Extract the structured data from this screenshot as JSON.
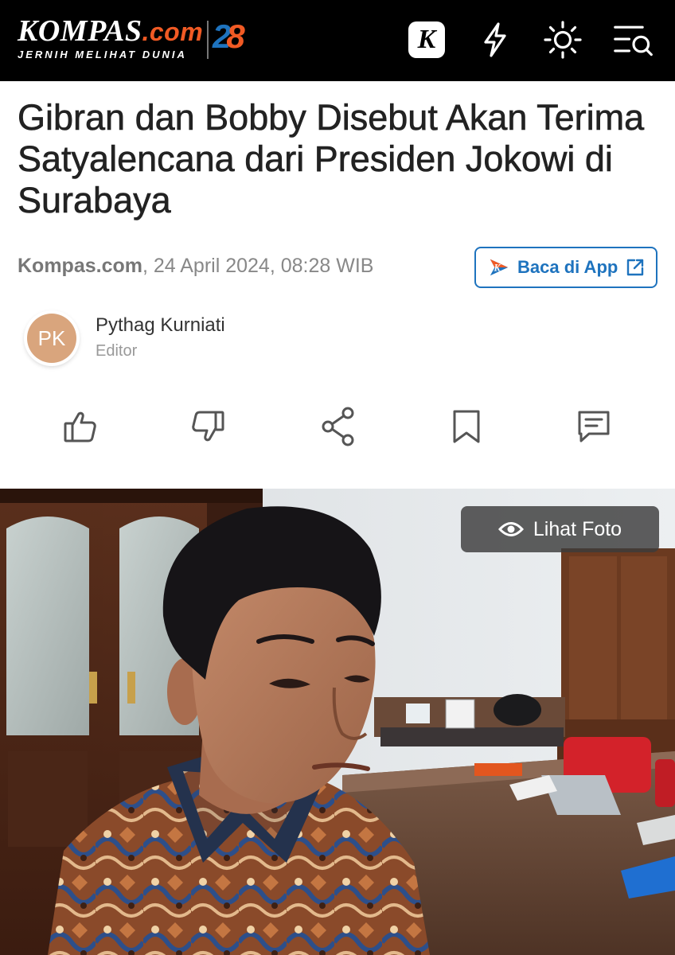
{
  "header": {
    "logo_name": "KOMPAS",
    "logo_dotcom": ".com",
    "logo_tagline": "JERNIH MELIHAT DUNIA",
    "logo_anniv_a": "2",
    "logo_anniv_b": "8",
    "k_badge": "K",
    "icons": [
      "k-badge-icon",
      "lightning-icon",
      "sun-icon",
      "menu-search-icon"
    ]
  },
  "article": {
    "title": "Gibran dan Bobby Disebut Akan Terima Satyalencana dari Presiden Jokowi di Surabaya",
    "source": "Kompas.com",
    "date": ", 24 April 2024, 08:28 WIB",
    "app_button": "Baca di App"
  },
  "author": {
    "initials": "PK",
    "name": "Pythag Kurniati",
    "role": "Editor"
  },
  "actions": [
    "like-icon",
    "dislike-icon",
    "share-icon",
    "bookmark-icon",
    "comment-icon"
  ],
  "photo": {
    "button_label": "Lihat Foto"
  },
  "colors": {
    "brand_blue": "#1e73be",
    "brand_orange": "#f15a24",
    "topbar": "#000000",
    "avatar": "#d9a57d"
  }
}
